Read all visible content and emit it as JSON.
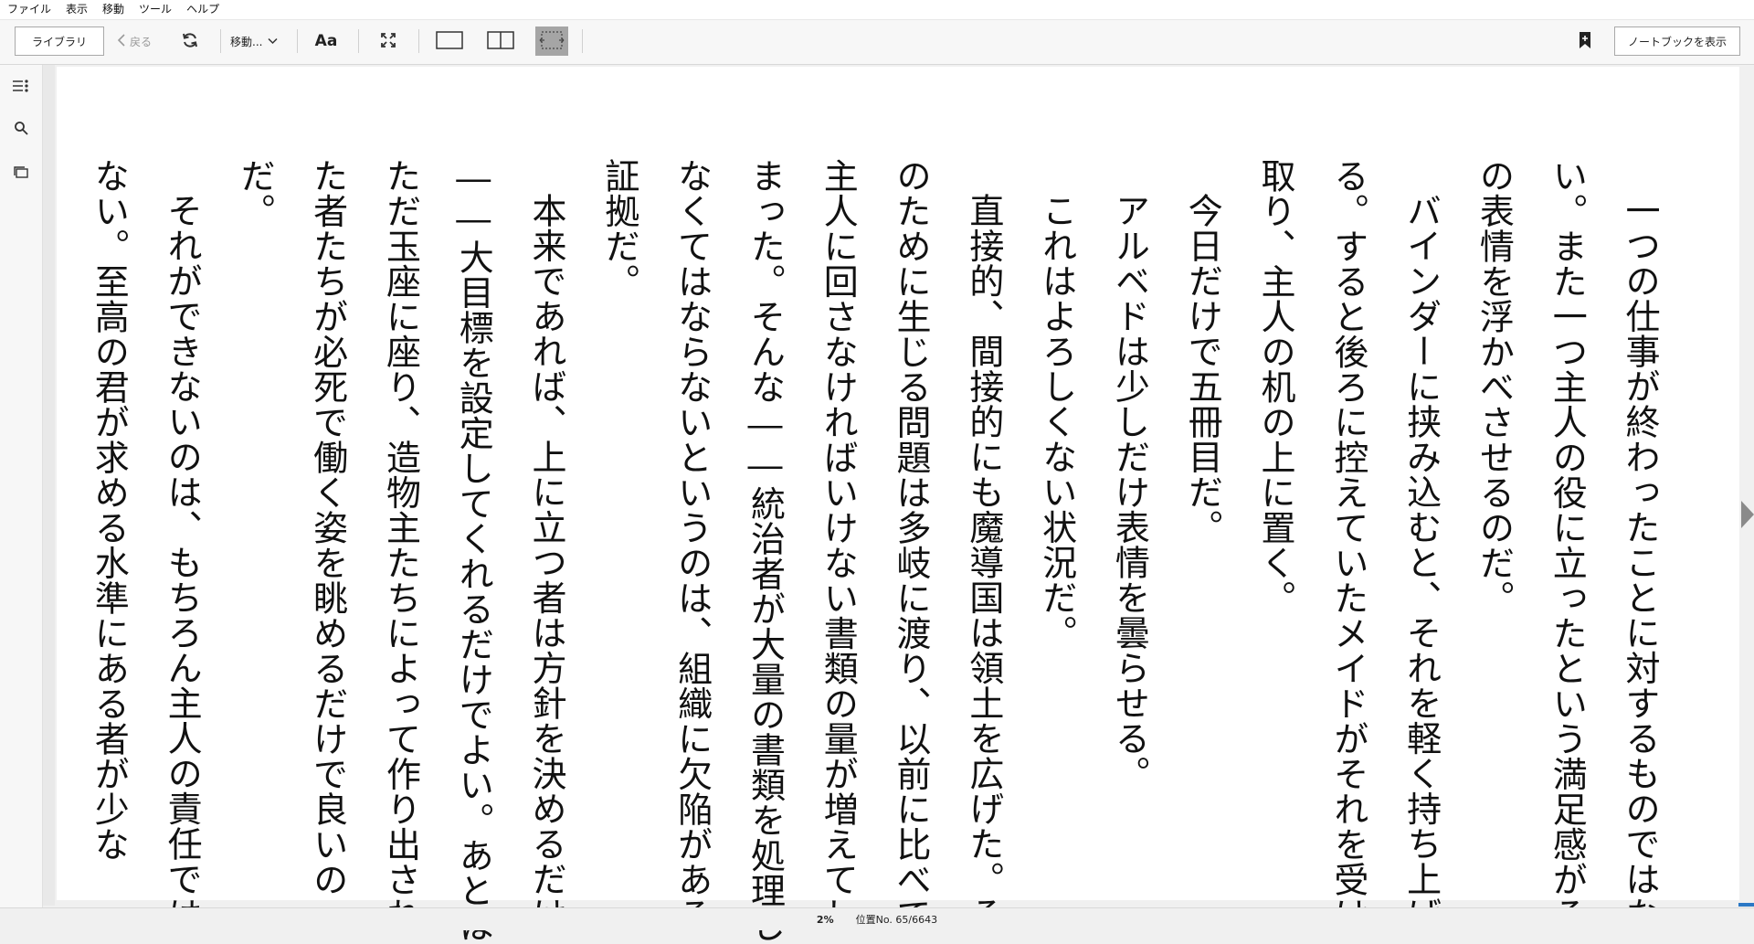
{
  "menu": [
    "ファイル",
    "表示",
    "移動",
    "ツール",
    "ヘルプ"
  ],
  "toolbar": {
    "library_label": "ライブラリ",
    "back_label": "戻る",
    "goto_label": "移動...",
    "font_label": "Aa",
    "notebook_label": "ノートブックを表示"
  },
  "icons": {
    "back": "chevron-left-icon",
    "refresh": "refresh-icon",
    "goto_dropdown": "chevron-down-icon",
    "fullscreen": "fullscreen-icon",
    "single_page": "single-page-icon",
    "two_page": "two-page-icon",
    "continuous": "continuous-scroll-icon",
    "bookmark": "bookmark-add-icon",
    "toc": "toc-icon",
    "search": "search-icon",
    "flashcards": "flashcards-icon",
    "next_page": "next-page-arrow-icon"
  },
  "colors": {
    "active_view": "#a5a5a5",
    "progress": "#2b78c5"
  },
  "paragraphs": [
    {
      "indent": true,
      "text": "一つの仕事が終わったことに対するものではない。また一つ主人の役に立ったという満足感がその表情を浮かべさせるのだ。"
    },
    {
      "indent": true,
      "text": "バインダーに挟み込むと、それを軽く持ち上げる。すると後ろに控えていたメイドがそれを受け取り、主人の机の上に置く。"
    },
    {
      "indent": true,
      "text": "今日だけで五冊目だ。"
    },
    {
      "indent": true,
      "text": "アルベドは少しだけ表情を曇らせる。"
    },
    {
      "indent": true,
      "text": "これはよろしくない状況だ。"
    },
    {
      "indent": true,
      "text": "直接的、間接的にも魔導国は領土を広げた。そのために生じる問題は多岐に渡り、以前に比べて主人に回さなければいけない書類の量が増えてしまった。そんな――統治者が大量の書類を処理しなくてはならないというのは、組織に欠陥がある証拠だ。"
    },
    {
      "indent": true,
      "text": "本来であれば、上に立つ者は方針を決めるだけ――大目標を設定してくれるだけでよい。あとはただ玉座に座り、造物主たちによって作り出された者たちが必死で働く姿を眺めるだけで良いのだ。"
    },
    {
      "indent": true,
      "text": "それができないのは、もちろん主人の責任ではない。至高の君が求める水準にある者が少な"
    }
  ],
  "status": {
    "percent": "2%",
    "location": "位置No. 65/6643",
    "progress_fraction": 0.0098
  }
}
